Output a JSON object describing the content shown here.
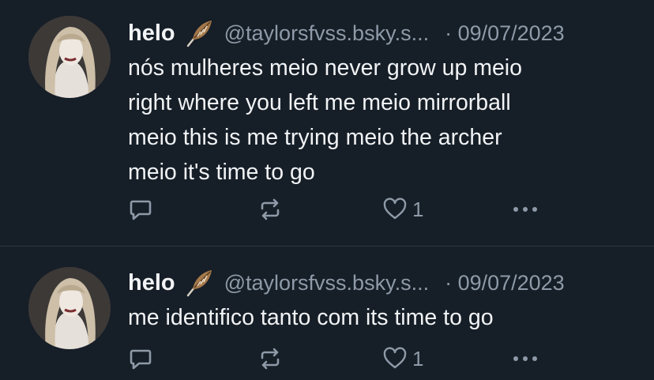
{
  "posts": [
    {
      "author_name": "helo",
      "handle": "@taylorsfvss.bsky.s...",
      "date": "· 09/07/2023",
      "lines": [
        "nós mulheres meio never grow up meio",
        "right where you left me meio mirrorball",
        "meio this is me trying meio the archer",
        "meio it's time to go"
      ],
      "like_count": "1"
    },
    {
      "author_name": "helo",
      "handle": "@taylorsfvss.bsky.s...",
      "date": "· 09/07/2023",
      "lines": [
        "me identifico tanto com its time to go"
      ],
      "like_count": "1"
    }
  ],
  "icons": {
    "name_badge": "feather-icon",
    "reply": "speech-bubble-icon",
    "repost": "repost-arrows-icon",
    "like": "heart-icon",
    "more": "ellipsis-icon"
  },
  "colors": {
    "background": "#161e27",
    "text": "#f1f3f5",
    "muted": "#8e9aa8",
    "divider": "#2b3643"
  }
}
